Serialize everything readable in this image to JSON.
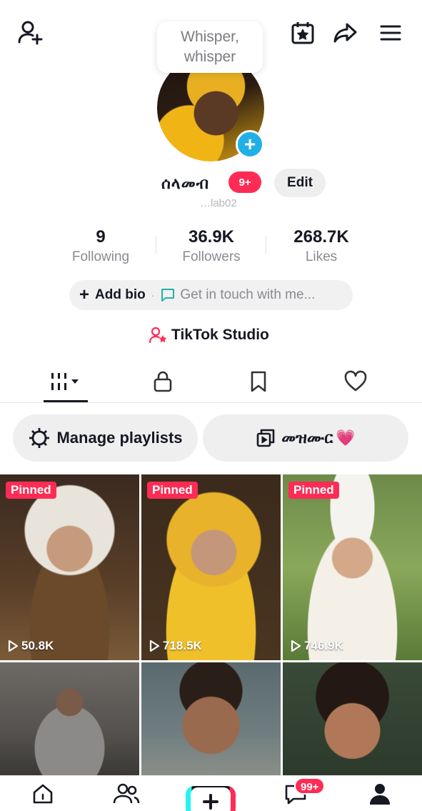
{
  "tooltip": {
    "text": "Whisper, whisper"
  },
  "profile": {
    "username": "ሰላመብ",
    "badge": "9+",
    "handle": "…lab02",
    "edit_label": "Edit"
  },
  "stats": {
    "following": {
      "value": "9",
      "label": "Following"
    },
    "followers": {
      "value": "36.9K",
      "label": "Followers"
    },
    "likes": {
      "value": "268.7K",
      "label": "Likes"
    }
  },
  "bio": {
    "add_label": "Add bio",
    "separator": "·",
    "contact_label": "Get in touch with me..."
  },
  "studio": {
    "label": "TikTok Studio"
  },
  "tabs": [
    {
      "name": "videos",
      "icon": "grid-videos-icon",
      "active": true
    },
    {
      "name": "private",
      "icon": "lock-icon",
      "active": false
    },
    {
      "name": "saved",
      "icon": "bookmark-icon",
      "active": false
    },
    {
      "name": "liked",
      "icon": "heart-outline-icon",
      "active": false
    }
  ],
  "playlists": {
    "manage_label": "Manage playlists",
    "playlist_label": "መዝሙር",
    "playlist_emoji": "💗"
  },
  "videos": [
    {
      "pinned_label": "Pinned",
      "views": "50.8K"
    },
    {
      "pinned_label": "Pinned",
      "views": "718.5K"
    },
    {
      "pinned_label": "Pinned",
      "views": "746.9K"
    },
    {
      "pinned_label": "",
      "views": ""
    },
    {
      "pinned_label": "",
      "views": ""
    },
    {
      "pinned_label": "",
      "views": ""
    }
  ],
  "bottom_nav": {
    "items": [
      "home-icon",
      "friends-icon",
      "create-icon",
      "inbox-icon",
      "profile-icon"
    ],
    "inbox_badge": "99+"
  },
  "colors": {
    "accent": "#fe2c55",
    "cyan": "#25f4ee",
    "text": "#161823",
    "muted": "#8a8b91",
    "avatar_plus": "#20b0e6"
  }
}
